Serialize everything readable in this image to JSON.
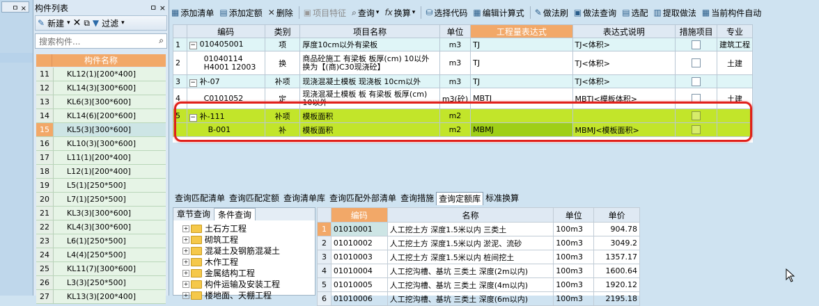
{
  "left_strip": {
    "pin_label": "ㅁ ×"
  },
  "component_panel": {
    "title": "构件列表",
    "pin": "ㅁ ×",
    "toolbar": {
      "new_label": "新建",
      "filter_label": "过滤"
    },
    "search_placeholder": "搜索构件...",
    "list_header": "构件名称",
    "items": [
      {
        "n": "11",
        "name": "KL12(1)[200*400]"
      },
      {
        "n": "12",
        "name": "KL14(3)[300*600]"
      },
      {
        "n": "13",
        "name": "KL6(3)[300*600]"
      },
      {
        "n": "14",
        "name": "KL14(6)[200*600]"
      },
      {
        "n": "15",
        "name": "KL5(3)[300*600]"
      },
      {
        "n": "16",
        "name": "KL10(3)[300*600]"
      },
      {
        "n": "17",
        "name": "L11(1)[200*400]"
      },
      {
        "n": "18",
        "name": "L12(1)[200*400]"
      },
      {
        "n": "19",
        "name": "L5(1)[250*500]"
      },
      {
        "n": "20",
        "name": "L7(1)[250*500]"
      },
      {
        "n": "21",
        "name": "KL3(3)[300*600]"
      },
      {
        "n": "22",
        "name": "KL4(3)[300*600]"
      },
      {
        "n": "23",
        "name": "L6(1)[250*500]"
      },
      {
        "n": "24",
        "name": "L4(4)[250*500]"
      },
      {
        "n": "25",
        "name": "KL11(7)[300*600]"
      },
      {
        "n": "26",
        "name": "L3(3)[250*500]"
      },
      {
        "n": "27",
        "name": "KL13(3)[200*400]"
      }
    ]
  },
  "toolbar": {
    "add_list": "添加清单",
    "add_quota": "添加定额",
    "delete": "删除",
    "item_feature": "项目特征",
    "query": "查询",
    "convert": "换算",
    "select_code": "选择代码",
    "edit_formula": "编辑计算式",
    "method_brush": "做法刷",
    "method_query": "做法查询",
    "select_match": "选配",
    "extract_method": "提取做法",
    "current_component": "当前构件自动"
  },
  "grid": {
    "headers": [
      "编码",
      "类别",
      "项目名称",
      "单位",
      "工程量表达式",
      "表达式说明",
      "措施项目",
      "专业"
    ],
    "rows": [
      {
        "n": "1",
        "tree": "−",
        "code": "010405001",
        "cat": "项",
        "name": "厚度10cm以外有梁板",
        "unit": "m3",
        "expr": "TJ",
        "desc": "TJ<体积>",
        "major": "建筑工程"
      },
      {
        "n": "2",
        "tree": "",
        "code": "01040114 H4001 12003",
        "cat": "换",
        "name": "商品砼施工 有梁板 板厚(cm) 10以外 换为【(商)C30现浇砼】",
        "unit": "m3",
        "expr": "TJ",
        "desc": "TJ<体积>",
        "major": "土建"
      },
      {
        "n": "3",
        "tree": "−",
        "code": "补-07",
        "cat": "补项",
        "name": "现浇混凝土模板 现浇板 10cm以外",
        "unit": "m3",
        "expr": "TJ",
        "desc": "TJ<体积>",
        "major": ""
      },
      {
        "n": "4",
        "tree": "",
        "code": "C0101052",
        "cat": "定",
        "name": "现浇混凝土模板 板 有梁板 板厚(cm) 10以外",
        "unit": "m3(砼)",
        "expr": "MBTJ",
        "desc": "MBTJ<模板体积>",
        "major": "土建"
      },
      {
        "n": "5",
        "tree": "−",
        "code": "补-111",
        "cat": "补项",
        "name": "模板面积",
        "unit": "m2",
        "expr": "",
        "desc": "",
        "major": ""
      },
      {
        "n": "",
        "tree": "",
        "code": "B-001",
        "cat": "补",
        "name": "模板面积",
        "unit": "m2",
        "expr": "MBMJ",
        "desc": "MBMJ<模板面积>",
        "major": ""
      }
    ]
  },
  "lower_tabs": [
    "查询匹配清单",
    "查询匹配定额",
    "查询清单库",
    "查询匹配外部清单",
    "查询措施",
    "查询定额库",
    "标准换算"
  ],
  "chapter": {
    "tabs": [
      "章节查询",
      "条件查询"
    ],
    "items": [
      "土石方工程",
      "砌筑工程",
      "混凝土及钢筋混凝土",
      "木作工程",
      "金属结构工程",
      "构件运输及安装工程",
      "楼地面、天棚工程"
    ]
  },
  "quota": {
    "headers": [
      "编码",
      "名称",
      "单位",
      "单价"
    ],
    "rows": [
      {
        "n": "1",
        "code": "01010001",
        "name": "人工挖土方 深度1.5米以内 三类土",
        "unit": "100m3",
        "price": "904.78"
      },
      {
        "n": "2",
        "code": "01010002",
        "name": "人工挖土方 深度1.5米以内 淤泥、流砂",
        "unit": "100m3",
        "price": "3049.2"
      },
      {
        "n": "3",
        "code": "01010003",
        "name": "人工挖土方 深度1.5米以内 桩间挖土",
        "unit": "100m3",
        "price": "1357.17"
      },
      {
        "n": "4",
        "code": "01010004",
        "name": "人工挖沟槽、基坑 三类土 深度(2m以内)",
        "unit": "100m3",
        "price": "1600.64"
      },
      {
        "n": "5",
        "code": "01010005",
        "name": "人工挖沟槽、基坑 三类土 深度(4m以内)",
        "unit": "100m3",
        "price": "1920.12"
      },
      {
        "n": "6",
        "code": "01010006",
        "name": "人工挖沟槽、基坑 三类土 深度(6m以内)",
        "unit": "100m3",
        "price": "2195.18"
      }
    ]
  }
}
